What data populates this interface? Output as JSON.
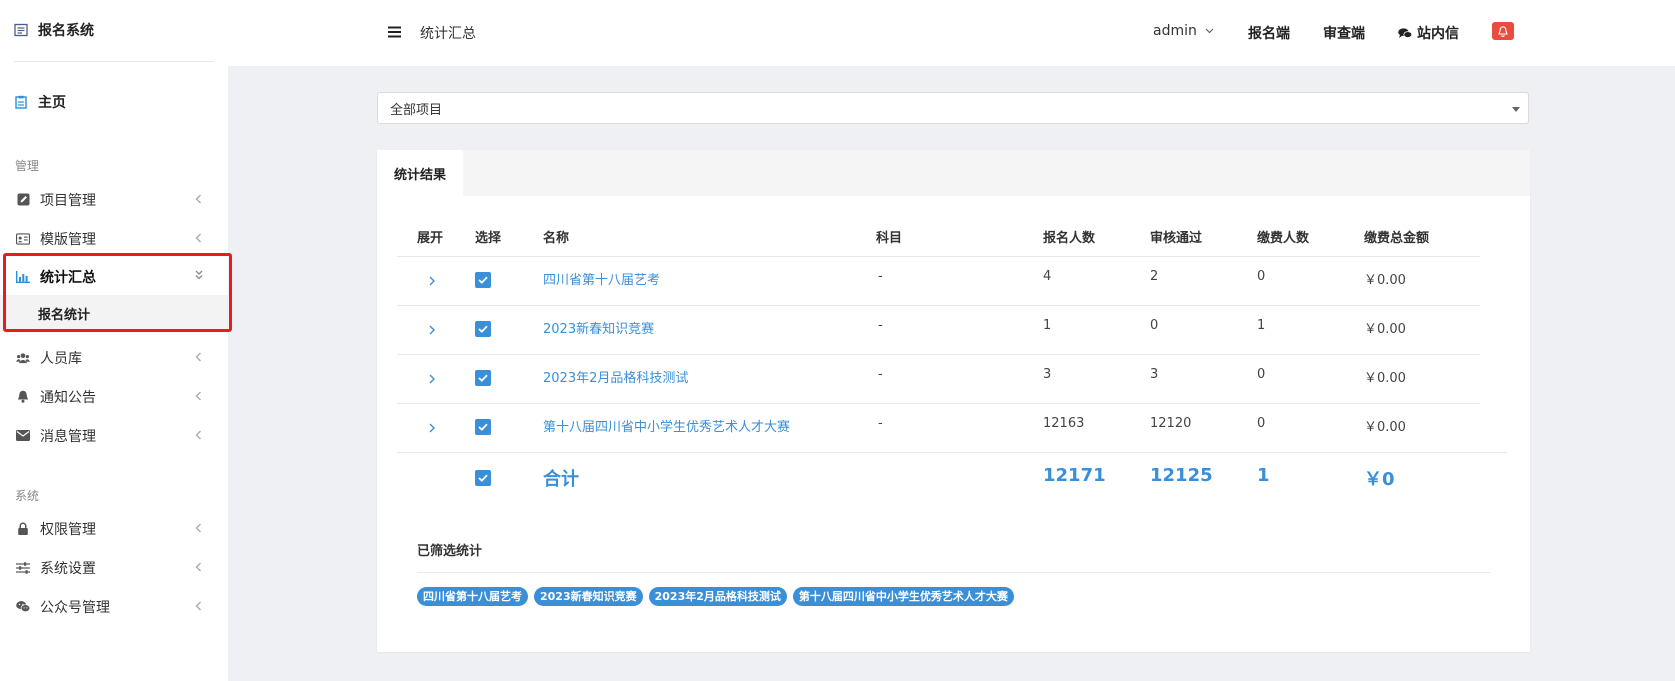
{
  "sidebar": {
    "brand": "报名系统",
    "home": "主页",
    "section_manage": "管理",
    "section_system": "系统",
    "items": [
      {
        "label": "项目管理",
        "icon": "edit-icon"
      },
      {
        "label": "模版管理",
        "icon": "id-card-icon"
      },
      {
        "label": "统计汇总",
        "icon": "bar-chart-icon",
        "active": true
      },
      {
        "label": "人员库",
        "icon": "users-icon"
      },
      {
        "label": "通知公告",
        "icon": "bell-icon"
      },
      {
        "label": "消息管理",
        "icon": "envelope-icon"
      },
      {
        "label": "权限管理",
        "icon": "lock-icon"
      },
      {
        "label": "系统设置",
        "icon": "sliders-icon"
      },
      {
        "label": "公众号管理",
        "icon": "wechat-icon"
      }
    ],
    "sub_item": "报名统计",
    "highlight_color": "#e81c1c"
  },
  "header": {
    "breadcrumb": "统计汇总",
    "user": "admin",
    "link_signup": "报名端",
    "link_review": "审查端",
    "link_messages": "站内信"
  },
  "filter": {
    "project_select": "全部项目"
  },
  "panel": {
    "tab": "统计结果",
    "columns": [
      "展开",
      "选择",
      "名称",
      "科目",
      "报名人数",
      "审核通过",
      "缴费人数",
      "缴费总金额"
    ],
    "rows": [
      {
        "name": "四川省第十八届艺考",
        "subject": "-",
        "registered": "4",
        "approved": "2",
        "paid": "0",
        "amount": "￥0.00"
      },
      {
        "name": "2023新春知识竞赛",
        "subject": "-",
        "registered": "1",
        "approved": "0",
        "paid": "1",
        "amount": "￥0.00"
      },
      {
        "name": "2023年2月品格科技测试",
        "subject": "-",
        "registered": "3",
        "approved": "3",
        "paid": "0",
        "amount": "￥0.00"
      },
      {
        "name": "第十八届四川省中小学生优秀艺术人才大赛",
        "subject": "-",
        "registered": "12163",
        "approved": "12120",
        "paid": "0",
        "amount": "￥0.00"
      }
    ],
    "total": {
      "label": "合计",
      "registered": "12171",
      "approved": "12125",
      "paid": "1",
      "amount": "￥0"
    },
    "filtered_title": "已筛选统计",
    "filtered_tags": [
      "四川省第十八届艺考",
      "2023新春知识竞赛",
      "2023年2月品格科技测试",
      "第十八届四川省中小学生优秀艺术人才大赛"
    ],
    "accent_color": "#3a8fd9"
  }
}
